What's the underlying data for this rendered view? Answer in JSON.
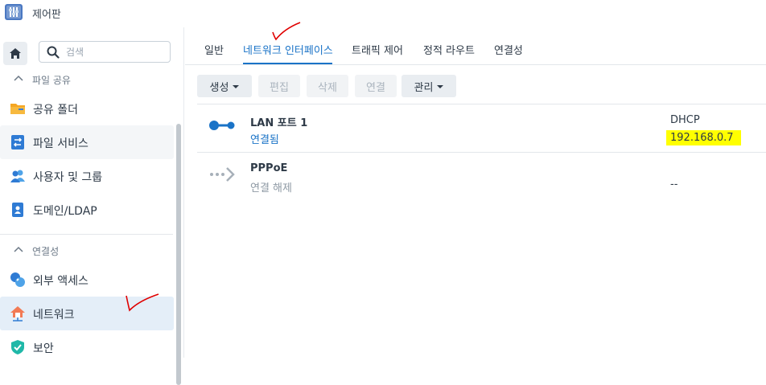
{
  "window": {
    "title": "제어판"
  },
  "sidebar": {
    "search_placeholder": "검색",
    "groups": [
      {
        "label": "파일 공유"
      },
      {
        "label": "연결성"
      }
    ],
    "items": [
      {
        "label": "공유 폴더",
        "icon": "folder-icon"
      },
      {
        "label": "파일 서비스",
        "icon": "file-services-icon"
      },
      {
        "label": "사용자 및 그룹",
        "icon": "users-icon"
      },
      {
        "label": "도메인/LDAP",
        "icon": "domain-icon"
      },
      {
        "label": "외부 액세스",
        "icon": "external-access-icon"
      },
      {
        "label": "네트워크",
        "icon": "network-icon",
        "selected": true
      },
      {
        "label": "보안",
        "icon": "shield-icon"
      }
    ]
  },
  "tabs": [
    {
      "label": "일반"
    },
    {
      "label": "네트워크 인터페이스",
      "active": true
    },
    {
      "label": "트래픽 제어"
    },
    {
      "label": "정적 라우트"
    },
    {
      "label": "연결성"
    }
  ],
  "toolbar": {
    "create": "생성",
    "edit": "편집",
    "delete": "삭제",
    "connect": "연결",
    "manage": "관리"
  },
  "interfaces": [
    {
      "name": "LAN 포트 1",
      "status": "연결됨",
      "mode": "DHCP",
      "ip": "192.168.0.7",
      "icon": "lan-connected-icon"
    },
    {
      "name": "PPPoE",
      "status": "연결 해제",
      "mode": "",
      "ip": "--",
      "icon": "pppoe-disconnected-icon"
    }
  ],
  "colors": {
    "accent": "#1a73c7",
    "highlight": "#ffff00",
    "annotation": "#e00000"
  }
}
